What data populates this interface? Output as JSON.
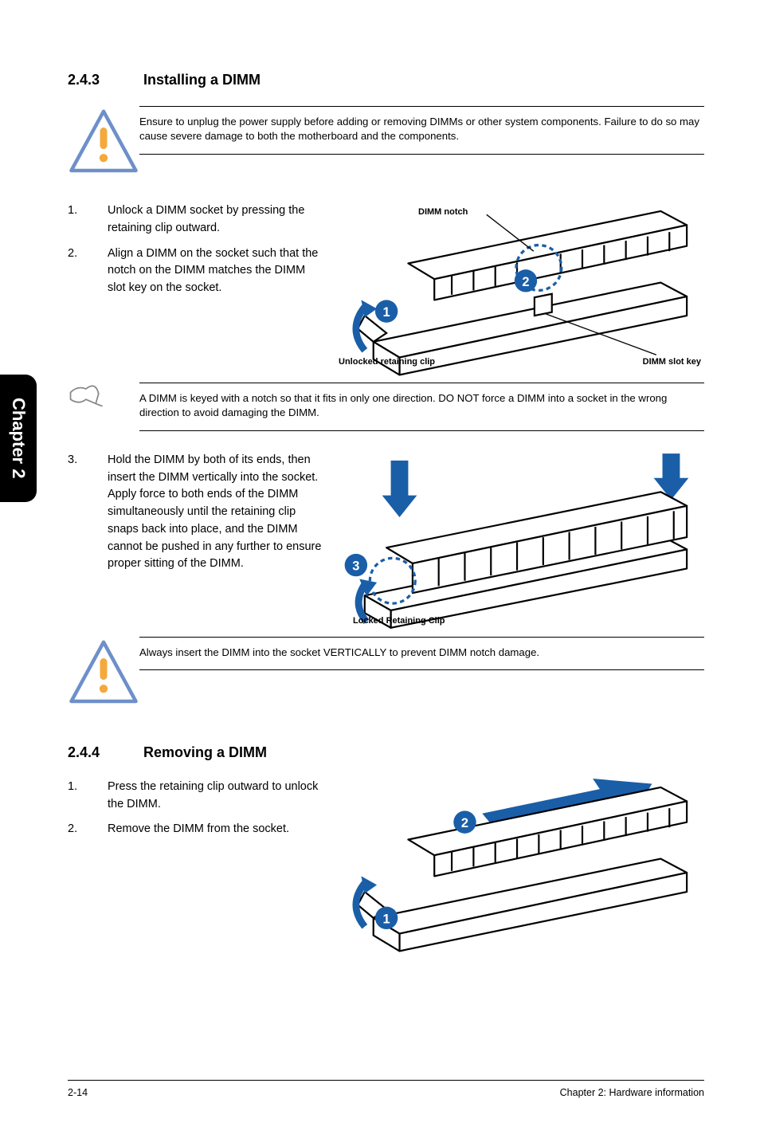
{
  "sideTab": "Chapter 2",
  "sec243": {
    "num": "2.4.3",
    "title": "Installing a DIMM",
    "caution": "Ensure to unplug the power supply before adding or removing DIMMs or other system components. Failure to do so may cause severe damage to both the motherboard and the components.",
    "steps12": [
      {
        "n": "1.",
        "t": "Unlock a DIMM socket by pressing the retaining clip outward."
      },
      {
        "n": "2.",
        "t": "Align a DIMM on the socket such that the notch on the DIMM matches the DIMM slot key on the socket."
      }
    ],
    "diag1": {
      "label_notch": "DIMM notch",
      "label_clip": "Unlocked retaining clip",
      "label_key": "DIMM slot key",
      "bubble1": "1",
      "bubble2": "2"
    },
    "note": "A DIMM is keyed with a notch so that it fits in only one direction. DO NOT force a DIMM into a socket in the wrong direction to avoid damaging the DIMM.",
    "step3": {
      "n": "3.",
      "t": "Hold the DIMM by both of its ends, then insert the DIMM vertically into the socket. Apply force to both ends of the DIMM simultaneously until the retaining clip snaps back into place, and the DIMM cannot be pushed in any further to ensure proper sitting of the DIMM."
    },
    "diag2": {
      "label_locked": "Locked Retaining Clip",
      "bubble3": "3"
    },
    "caution2": "Always insert the DIMM into the socket VERTICALLY to prevent DIMM notch damage."
  },
  "sec244": {
    "num": "2.4.4",
    "title": "Removing a DIMM",
    "steps": [
      {
        "n": "1.",
        "t": "Press the retaining clip outward to unlock the DIMM."
      },
      {
        "n": "2.",
        "t": "Remove the DIMM from the socket."
      }
    ],
    "diag": {
      "bubble1": "1",
      "bubble2": "2"
    }
  },
  "footer": {
    "left": "2-14",
    "right": "Chapter 2: Hardware information"
  }
}
